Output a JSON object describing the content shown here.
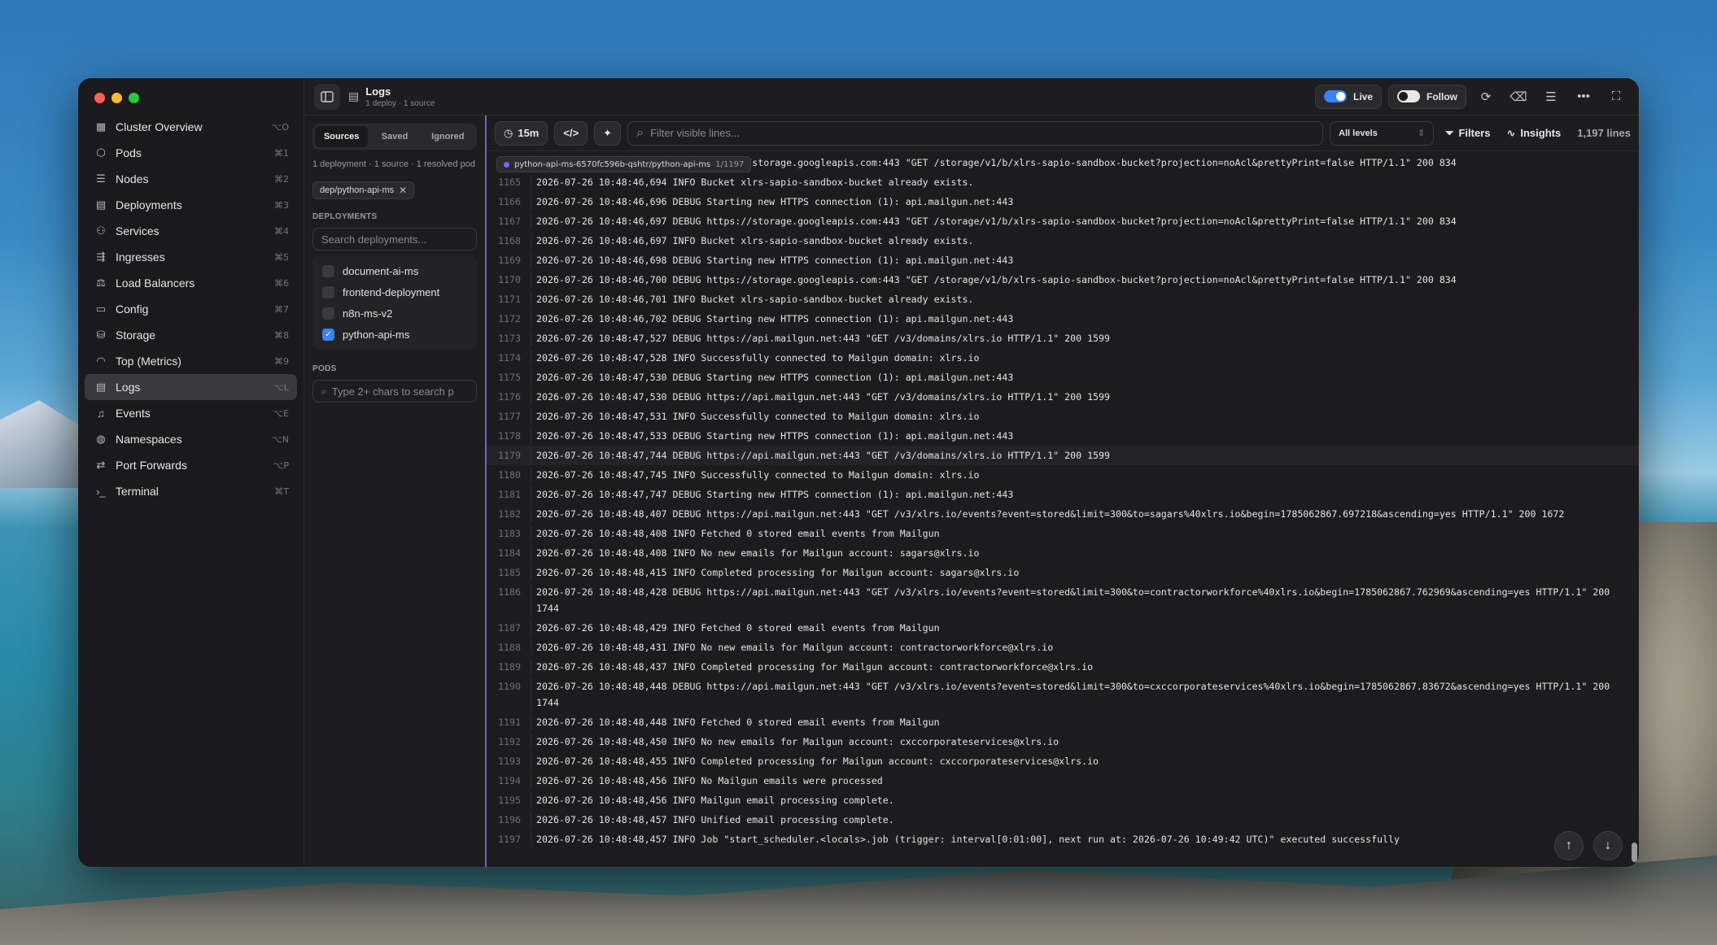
{
  "window": {
    "title": "Logs",
    "subtitle": "1 deploy · 1 source"
  },
  "sidebar": {
    "items": [
      {
        "label": "Cluster Overview",
        "shortcut": "⌥O",
        "icon": "grid-icon"
      },
      {
        "label": "Pods",
        "shortcut": "⌘1",
        "icon": "cube-icon"
      },
      {
        "label": "Nodes",
        "shortcut": "⌘2",
        "icon": "server-icon"
      },
      {
        "label": "Deployments",
        "shortcut": "⌘3",
        "icon": "layout-icon"
      },
      {
        "label": "Services",
        "shortcut": "⌘4",
        "icon": "network-icon"
      },
      {
        "label": "Ingresses",
        "shortcut": "⌘5",
        "icon": "ingress-icon"
      },
      {
        "label": "Load Balancers",
        "shortcut": "⌘6",
        "icon": "loadbalancer-icon"
      },
      {
        "label": "Config",
        "shortcut": "⌘7",
        "icon": "file-icon"
      },
      {
        "label": "Storage",
        "shortcut": "⌘8",
        "icon": "storage-icon"
      },
      {
        "label": "Top (Metrics)",
        "shortcut": "⌘9",
        "icon": "gauge-icon"
      },
      {
        "label": "Logs",
        "shortcut": "⌥L",
        "icon": "logs-icon"
      },
      {
        "label": "Events",
        "shortcut": "⌥E",
        "icon": "bell-icon"
      },
      {
        "label": "Namespaces",
        "shortcut": "⌥N",
        "icon": "globe-icon"
      },
      {
        "label": "Port Forwards",
        "shortcut": "⌥P",
        "icon": "arrows-icon"
      },
      {
        "label": "Terminal",
        "shortcut": "⌘T",
        "icon": "terminal-icon"
      }
    ]
  },
  "topbar": {
    "live_label": "Live",
    "follow_label": "Follow"
  },
  "panel": {
    "tabs": [
      "Sources",
      "Saved",
      "Ignored"
    ],
    "info": "1 deployment · 1 source · 1 resolved pod",
    "chip": "dep/python-api-ms",
    "deployments_label": "DEPLOYMENTS",
    "deployments_placeholder": "Search deployments...",
    "deployments": [
      {
        "name": "document-ai-ms",
        "checked": false
      },
      {
        "name": "frontend-deployment",
        "checked": false
      },
      {
        "name": "n8n-ms-v2",
        "checked": false
      },
      {
        "name": "python-api-ms",
        "checked": true
      }
    ],
    "pods_label": "PODS",
    "pods_placeholder": "Type 2+ chars to search p"
  },
  "toolbar": {
    "time_range": "15m",
    "filter_placeholder": "Filter visible lines...",
    "levels": "All levels",
    "filters_label": "Filters",
    "insights_label": "Insights",
    "line_count": "1,197 lines"
  },
  "source_badge": {
    "name": "python-api-ms-6570fc596b-qshtr/python-api-ms",
    "count": "1/1197"
  },
  "logs": [
    {
      "n": "",
      "t": "2026-07-26 10:48:46,694 DEBUG https://storage.googleapis.com:443 \"GET /storage/v1/b/xlrs-sapio-sandbox-bucket?projection=noAcl&prettyPrint=false HTTP/1.1\" 200 834"
    },
    {
      "n": "1165",
      "t": "2026-07-26 10:48:46,694 INFO Bucket xlrs-sapio-sandbox-bucket already exists."
    },
    {
      "n": "1166",
      "t": "2026-07-26 10:48:46,696 DEBUG Starting new HTTPS connection (1): api.mailgun.net:443"
    },
    {
      "n": "1167",
      "t": "2026-07-26 10:48:46,697 DEBUG https://storage.googleapis.com:443 \"GET /storage/v1/b/xlrs-sapio-sandbox-bucket?projection=noAcl&prettyPrint=false HTTP/1.1\" 200 834"
    },
    {
      "n": "1168",
      "t": "2026-07-26 10:48:46,697 INFO Bucket xlrs-sapio-sandbox-bucket already exists."
    },
    {
      "n": "1169",
      "t": "2026-07-26 10:48:46,698 DEBUG Starting new HTTPS connection (1): api.mailgun.net:443"
    },
    {
      "n": "1170",
      "t": "2026-07-26 10:48:46,700 DEBUG https://storage.googleapis.com:443 \"GET /storage/v1/b/xlrs-sapio-sandbox-bucket?projection=noAcl&prettyPrint=false HTTP/1.1\" 200 834"
    },
    {
      "n": "1171",
      "t": "2026-07-26 10:48:46,701 INFO Bucket xlrs-sapio-sandbox-bucket already exists."
    },
    {
      "n": "1172",
      "t": "2026-07-26 10:48:46,702 DEBUG Starting new HTTPS connection (1): api.mailgun.net:443"
    },
    {
      "n": "1173",
      "t": "2026-07-26 10:48:47,527 DEBUG https://api.mailgun.net:443 \"GET /v3/domains/xlrs.io HTTP/1.1\" 200 1599"
    },
    {
      "n": "1174",
      "t": "2026-07-26 10:48:47,528 INFO Successfully connected to Mailgun domain: xlrs.io"
    },
    {
      "n": "1175",
      "t": "2026-07-26 10:48:47,530 DEBUG Starting new HTTPS connection (1): api.mailgun.net:443"
    },
    {
      "n": "1176",
      "t": "2026-07-26 10:48:47,530 DEBUG https://api.mailgun.net:443 \"GET /v3/domains/xlrs.io HTTP/1.1\" 200 1599"
    },
    {
      "n": "1177",
      "t": "2026-07-26 10:48:47,531 INFO Successfully connected to Mailgun domain: xlrs.io"
    },
    {
      "n": "1178",
      "t": "2026-07-26 10:48:47,533 DEBUG Starting new HTTPS connection (1): api.mailgun.net:443"
    },
    {
      "n": "1179",
      "t": "2026-07-26 10:48:47,744 DEBUG https://api.mailgun.net:443 \"GET /v3/domains/xlrs.io HTTP/1.1\" 200 1599"
    },
    {
      "n": "1180",
      "t": "2026-07-26 10:48:47,745 INFO Successfully connected to Mailgun domain: xlrs.io"
    },
    {
      "n": "1181",
      "t": "2026-07-26 10:48:47,747 DEBUG Starting new HTTPS connection (1): api.mailgun.net:443"
    },
    {
      "n": "1182",
      "t": "2026-07-26 10:48:48,407 DEBUG https://api.mailgun.net:443 \"GET /v3/xlrs.io/events?event=stored&limit=300&to=sagars%40xlrs.io&begin=1785062867.697218&ascending=yes HTTP/1.1\" 200 1672"
    },
    {
      "n": "1183",
      "t": "2026-07-26 10:48:48,408 INFO Fetched 0 stored email events from Mailgun"
    },
    {
      "n": "1184",
      "t": "2026-07-26 10:48:48,408 INFO No new emails for Mailgun account: sagars@xlrs.io"
    },
    {
      "n": "1185",
      "t": "2026-07-26 10:48:48,415 INFO Completed processing for Mailgun account: sagars@xlrs.io"
    },
    {
      "n": "1186",
      "t": "2026-07-26 10:48:48,428 DEBUG https://api.mailgun.net:443 \"GET /v3/xlrs.io/events?event=stored&limit=300&to=contractorworkforce%40xlrs.io&begin=1785062867.762969&ascending=yes HTTP/1.1\" 200 1744"
    },
    {
      "n": "1187",
      "t": "2026-07-26 10:48:48,429 INFO Fetched 0 stored email events from Mailgun"
    },
    {
      "n": "1188",
      "t": "2026-07-26 10:48:48,431 INFO No new emails for Mailgun account: contractorworkforce@xlrs.io"
    },
    {
      "n": "1189",
      "t": "2026-07-26 10:48:48,437 INFO Completed processing for Mailgun account: contractorworkforce@xlrs.io"
    },
    {
      "n": "1190",
      "t": "2026-07-26 10:48:48,448 DEBUG https://api.mailgun.net:443 \"GET /v3/xlrs.io/events?event=stored&limit=300&to=cxccorporateservices%40xlrs.io&begin=1785062867.83672&ascending=yes HTTP/1.1\" 200 1744"
    },
    {
      "n": "1191",
      "t": "2026-07-26 10:48:48,448 INFO Fetched 0 stored email events from Mailgun"
    },
    {
      "n": "1192",
      "t": "2026-07-26 10:48:48,450 INFO No new emails for Mailgun account: cxccorporateservices@xlrs.io"
    },
    {
      "n": "1193",
      "t": "2026-07-26 10:48:48,455 INFO Completed processing for Mailgun account: cxccorporateservices@xlrs.io"
    },
    {
      "n": "1194",
      "t": "2026-07-26 10:48:48,456 INFO No Mailgun emails were processed"
    },
    {
      "n": "1195",
      "t": "2026-07-26 10:48:48,456 INFO Mailgun email processing complete."
    },
    {
      "n": "1196",
      "t": "2026-07-26 10:48:48,457 INFO Unified email processing complete."
    },
    {
      "n": "1197",
      "t": "2026-07-26 10:48:48,457 INFO Job \"start_scheduler.<locals>.job (trigger: interval[0:01:00], next run at: 2026-07-26 10:49:42 UTC)\" executed successfully"
    }
  ],
  "highlighted_line": "1179",
  "colors": {
    "accent": "#3b82f6",
    "source_accent": "#8b5cf6"
  }
}
